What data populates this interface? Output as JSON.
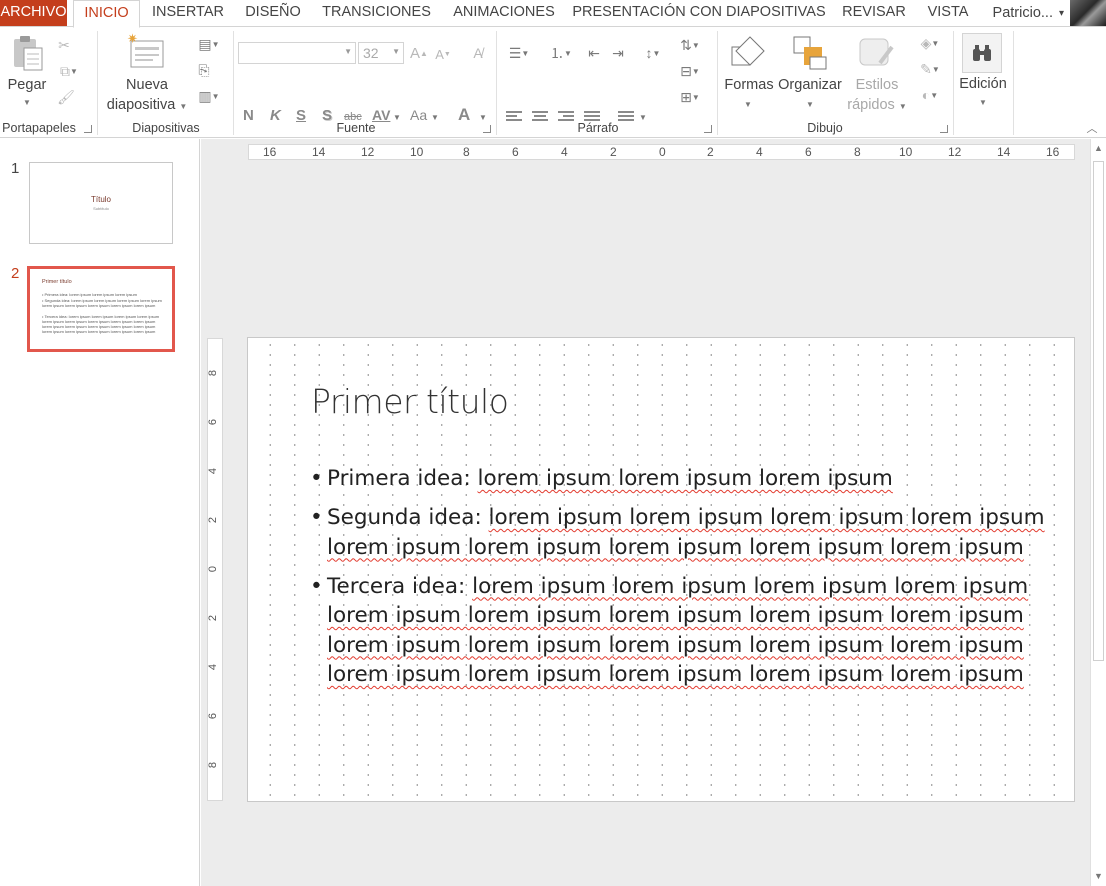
{
  "tabs": [
    "ARCHIVO",
    "INICIO",
    "INSERTAR",
    "DISEÑO",
    "TRANSICIONES",
    "ANIMACIONES",
    "PRESENTACIÓN CON DIAPOSITIVAS",
    "REVISAR",
    "VISTA"
  ],
  "active_tab": "INICIO",
  "user": {
    "name": "Patricio...",
    "caret": "▾"
  },
  "ribbon": {
    "groups": {
      "clipboard": "Portapapeles",
      "slides": "Diapositivas",
      "font": "Fuente",
      "paragraph": "Párrafo",
      "drawing": "Dibujo"
    },
    "paste_label": "Pegar",
    "new_slide_label_1": "Nueva",
    "new_slide_label_2": "diapositiva",
    "font_name_value": "",
    "font_size_value": "32",
    "shapes_label": "Formas",
    "arrange_label": "Organizar",
    "styles_label_1": "Estilos",
    "styles_label_2": "rápidos",
    "editing_label": "Edición",
    "format_letters": {
      "bold": "N",
      "italic": "K",
      "underline": "S",
      "shadow": "S",
      "strike": "abc",
      "spacing": "AV",
      "case": "Aa",
      "color": "A"
    }
  },
  "thumbnails": [
    {
      "number": "1",
      "title": "Título",
      "subtitle": "Subtítulo",
      "selected": false
    },
    {
      "number": "2",
      "title": "Primer título",
      "selected": true,
      "bullets": [
        "• Primera idea: lorem ipsum lorem ipsum lorem ipsum",
        "• Segunda idea: lorem ipsum lorem ipsum lorem ipsum lorem ipsum lorem ipsum lorem ipsum lorem ipsum lorem ipsum lorem ipsum",
        "• Tercera idea: lorem ipsum lorem ipsum lorem ipsum lorem ipsum lorem ipsum lorem ipsum lorem ipsum lorem ipsum lorem ipsum lorem ipsum lorem ipsum lorem ipsum lorem ipsum lorem ipsum lorem ipsum lorem ipsum lorem ipsum lorem ipsum lorem ipsum"
      ]
    }
  ],
  "ruler": {
    "horizontal": [
      "16",
      "14",
      "12",
      "10",
      "8",
      "6",
      "4",
      "2",
      "0",
      "2",
      "4",
      "6",
      "8",
      "10",
      "12",
      "14",
      "16"
    ],
    "vertical": [
      "8",
      "6",
      "4",
      "2",
      "0",
      "2",
      "4",
      "6",
      "8"
    ]
  },
  "slide": {
    "title": "Primer título",
    "bullets": [
      {
        "label": "Primera idea:",
        "text": "lorem ipsum lorem ipsum lorem ipsum"
      },
      {
        "label": "Segunda idea:",
        "text": "lorem ipsum lorem ipsum lorem ipsum lorem ipsum lorem ipsum lorem ipsum lorem ipsum lorem ipsum lorem ipsum"
      },
      {
        "label": "Tercera idea:",
        "text": "lorem ipsum lorem ipsum lorem ipsum lorem ipsum lorem ipsum lorem ipsum lorem ipsum lorem ipsum lorem ipsum lorem ipsum lorem ipsum lorem ipsum lorem ipsum lorem ipsum lorem ipsum lorem ipsum lorem ipsum lorem ipsum lorem ipsum"
      }
    ]
  },
  "colors": {
    "accent": "#c43e1c",
    "selection": "#e2574c",
    "spell": "#e23a2e"
  }
}
